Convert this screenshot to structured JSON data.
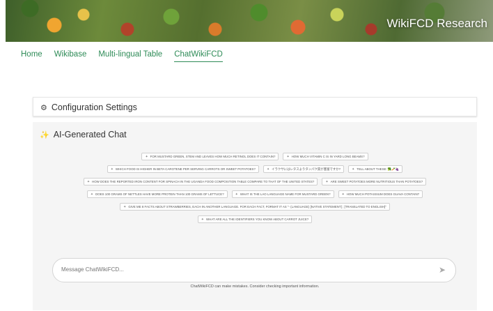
{
  "header": {
    "title": "WikiFCD Research"
  },
  "nav": [
    {
      "label": "Home",
      "active": false
    },
    {
      "label": "Wikibase",
      "active": false
    },
    {
      "label": "Multi-lingual Table",
      "active": false
    },
    {
      "label": "ChatWikiFCD",
      "active": true
    }
  ],
  "config": {
    "title": "Configuration Settings",
    "icon": "gear-icon"
  },
  "chat": {
    "title": "AI-Generated Chat",
    "icon": "magic-wand-icon",
    "suggestions": [
      [
        "For mustard green, stem and leaves how much retinol does it contain?",
        "How much Vitamin C is in yard long beams?"
      ],
      [
        "Which food is higher in beta carotene per serving carrots or sweet potatoes?",
        "イラクサにはレタスよりタンパク質が豊富ですか?",
        "Tell about these: 🥦🥕🍇"
      ],
      [
        "How does the reported iron content for spinach in the Uganda food composition table compare to that of the United States?",
        "Are sweet potatoes more nutritious than potatoes?"
      ],
      [
        "Does 100 grams of nettles have more protein than 100 grams of lettuce?",
        "What is the Lao language name for mustard green?",
        "How much potassium does guava contain?"
      ],
      [
        "Give me 8 facts about strawberries, each in another language. For each fact, format it as \"- (Language) [Native Statement] ; [Translated to English]\""
      ],
      [
        "What are all the identifiers you know about carrot juice?"
      ]
    ],
    "input_placeholder": "Message ChatWikiFCD...",
    "disclaimer": "ChatWikiFCD can make mistakes. Consider checking important information."
  }
}
